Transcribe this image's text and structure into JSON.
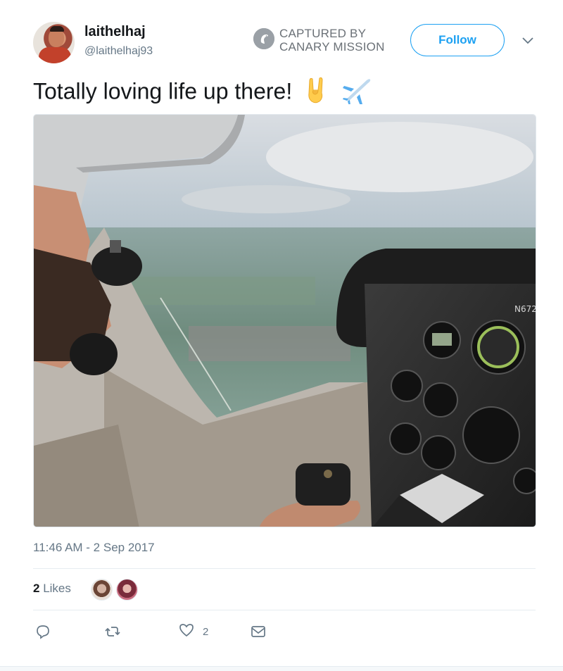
{
  "user": {
    "display_name": "laithelhaj",
    "handle": "@laithelhaj93"
  },
  "watermark": {
    "line1": "CAPTURED BY",
    "line2": "CANARY MISSION",
    "logo_icon": "canary-bird-icon"
  },
  "follow_button": {
    "label": "Follow",
    "color": "#1da1f2"
  },
  "menu_icon": "chevron-down-icon",
  "tweet": {
    "text": "Totally loving life up there!",
    "emojis": [
      "sign-of-horns-emoji",
      "airplane-emoji"
    ],
    "timestamp": "11:46 AM - 2 Sep 2017"
  },
  "photo": {
    "description_icon": "photo-cockpit",
    "panel_text": "N672"
  },
  "likes": {
    "count": "2",
    "label": "Likes"
  },
  "actions": {
    "reply_icon": "reply-icon",
    "retweet_icon": "retweet-icon",
    "like_icon": "heart-icon",
    "like_count": "2",
    "dm_icon": "envelope-icon"
  }
}
